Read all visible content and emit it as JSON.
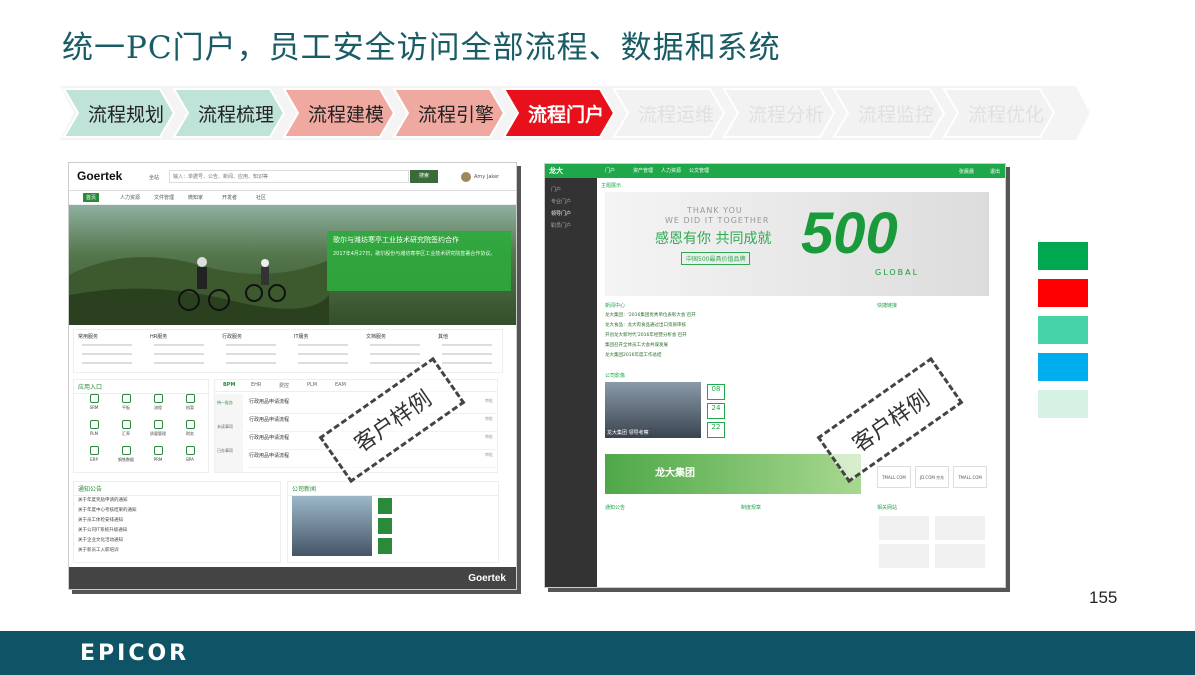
{
  "title": "统一PC门户，员工安全访问全部流程、数据和系统",
  "steps": [
    {
      "label": "流程规划",
      "bg": "#bfe3d8",
      "color": "#222"
    },
    {
      "label": "流程梳理",
      "bg": "#bfe3d8",
      "color": "#222"
    },
    {
      "label": "流程建模",
      "bg": "#f0a9a0",
      "color": "#222"
    },
    {
      "label": "流程引擎",
      "bg": "#f0a9a0",
      "color": "#222"
    },
    {
      "label": "流程门户",
      "bg": "#e8101a",
      "color": "#ffffff"
    },
    {
      "label": "流程运维",
      "bg": "#f2f2f2",
      "color": "#e0e0e0"
    },
    {
      "label": "流程分析",
      "bg": "#f2f2f2",
      "color": "#e0e0e0"
    },
    {
      "label": "流程监控",
      "bg": "#f2f2f2",
      "color": "#e0e0e0"
    },
    {
      "label": "流程优化",
      "bg": "#f2f2f2",
      "color": "#e0e0e0"
    }
  ],
  "goertek": {
    "logo": "Goertek",
    "search_scope": "全站",
    "search_placeholder": "输入：单据号、公告、新闻、应用、知识等",
    "search_button": "搜索",
    "user": "Amy Jaker",
    "nav": [
      "首页",
      "人力资源",
      "文件管理",
      "微知家",
      "开发者",
      "社区"
    ],
    "banner_title": "歌尔与潍坊寒亭工业技术研究院签约合作",
    "banner_text": "2017年4月27日，歌尔股份与潍坊寒亭区工业技术研究院签署合作协议。",
    "services": [
      "常用服务",
      "HR服务",
      "行政服务",
      "IT服务",
      "文档服务",
      "其他"
    ],
    "apps_title": "应用入口",
    "apps": [
      "SRM",
      "平板",
      "流程",
      "档案",
      "PLM",
      "汇率",
      "质量管理",
      "财务",
      "ERP",
      "钢铁数据",
      "PRM",
      "BPA"
    ],
    "tabs": [
      "BPM",
      "EHR",
      "费控",
      "PLM",
      "EAM"
    ],
    "todo_labels": [
      "待一批办",
      "未读事项",
      "已办事项"
    ],
    "todo_items": [
      "行政用品申请流程",
      "行政用品申请流程",
      "行政用品申请流程",
      "行政用品申请流程"
    ],
    "todo_status": "审批",
    "notice_title": "通知公告",
    "news_title": "公司新闻",
    "notices": [
      "关于年度奖励申请的通知",
      "关于年度中心考核结果的通知",
      "关于员工体检安排通知",
      "关于公司IT系统升级通知",
      "关于企业文化活动通知",
      "关于新员工入职培训"
    ],
    "footer_brand": "Goertek",
    "more": "更多"
  },
  "longda": {
    "logo": "龙大",
    "nav": [
      "门户",
      "资产管理",
      "人力资源",
      "公文管理"
    ],
    "user": "张晨晨",
    "logout": "退出",
    "side": [
      "门户",
      "专业门户",
      "领导门户",
      "职员门户"
    ],
    "banner_section": "主题展示",
    "banner_thank1": "THANK YOU",
    "banner_thank2": "WE DID IT TOGETHER",
    "banner_cn": "感恩有你  共同成就",
    "banner_500": "500",
    "banner_global": "GLOBAL",
    "banner_tag": "中国500最具价值品牌",
    "news_section": "新闻中心",
    "news": [
      "龙大集团：‘2016集团优秀单位表彰大会’召开",
      "龙大食品：龙大肉食品通过出口资质审核",
      "开创龙大新时代‘2016年经营分析会’召开",
      "集团召开全体员工大会共谋发展",
      "龙大集团2016年度工作总结"
    ],
    "photo_section": "公司影像",
    "photo_caption": "龙大集团 领导考察",
    "dates": [
      "08",
      "24",
      "22"
    ],
    "group_banner": "龙大集团",
    "notify": "通知公告",
    "rules": "制度规章",
    "links_title": "快捷链接",
    "partners": [
      "TMALL.COM",
      "JD.COM 京东",
      "TMALL.COM"
    ],
    "brands_title": "相关网站"
  },
  "stamp_text": "客户样例",
  "swatches": [
    "#00a850",
    "#ff0000",
    "#44d4a8",
    "#00aef0",
    "#d6f2e4"
  ],
  "page_number": "155",
  "footer_logo": "EPICOR"
}
